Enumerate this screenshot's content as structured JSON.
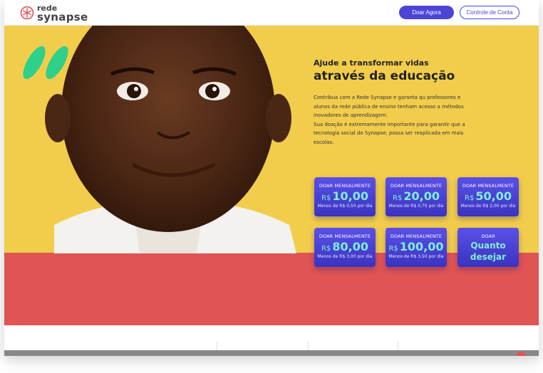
{
  "header": {
    "logo_line1": "rede",
    "logo_line2": "synapse",
    "donate_now": "Doar Agora",
    "account_control": "Controle de Conta"
  },
  "hero": {
    "headline_line1": "Ajude a transformar vidas",
    "headline_line2": "através da educação",
    "paragraph1": "Contribua com a Rede Synapse e garanta qu professores e alunos da rede pública de ensino tenham acesso a métodos inovadores de aprendizagem.",
    "paragraph2": "Sua doação é extremamente importante para garantir que a tecnologia social do Synapse, possa ser reaplicada em mais escolas."
  },
  "donation_cards": [
    {
      "title": "DOAR MENSALMENTE",
      "currency": "R$",
      "amount": "10,00",
      "sub": "Menos de R$ 0,50 por dia"
    },
    {
      "title": "DOAR MENSALMENTE",
      "currency": "R$",
      "amount": "20,00",
      "sub": "Menos de R$ 0,70 por dia"
    },
    {
      "title": "DOAR MENSALMENTE",
      "currency": "R$",
      "amount": "50,00",
      "sub": "Menos de R$ 2,00 por dia"
    },
    {
      "title": "DOAR MENSALMENTE",
      "currency": "R$",
      "amount": "80,00",
      "sub": "Menos de R$ 3,00 por dia"
    },
    {
      "title": "DOAR MENSALMENTE",
      "currency": "R$",
      "amount": "100,00",
      "sub": "Menos de R$ 3,50 por dia"
    },
    {
      "title": "DOAR",
      "custom_line1": "Quanto",
      "custom_line2": "desejar"
    }
  ],
  "colors": {
    "brand": "#4b45d6",
    "yellow": "#f2cd4c",
    "red": "#e05454",
    "accent_teal": "#7ef0d8",
    "quote_green": "#2fd08a"
  },
  "icons": {
    "logo": "synapse-logo-icon",
    "quote": "quote-marks-icon"
  }
}
